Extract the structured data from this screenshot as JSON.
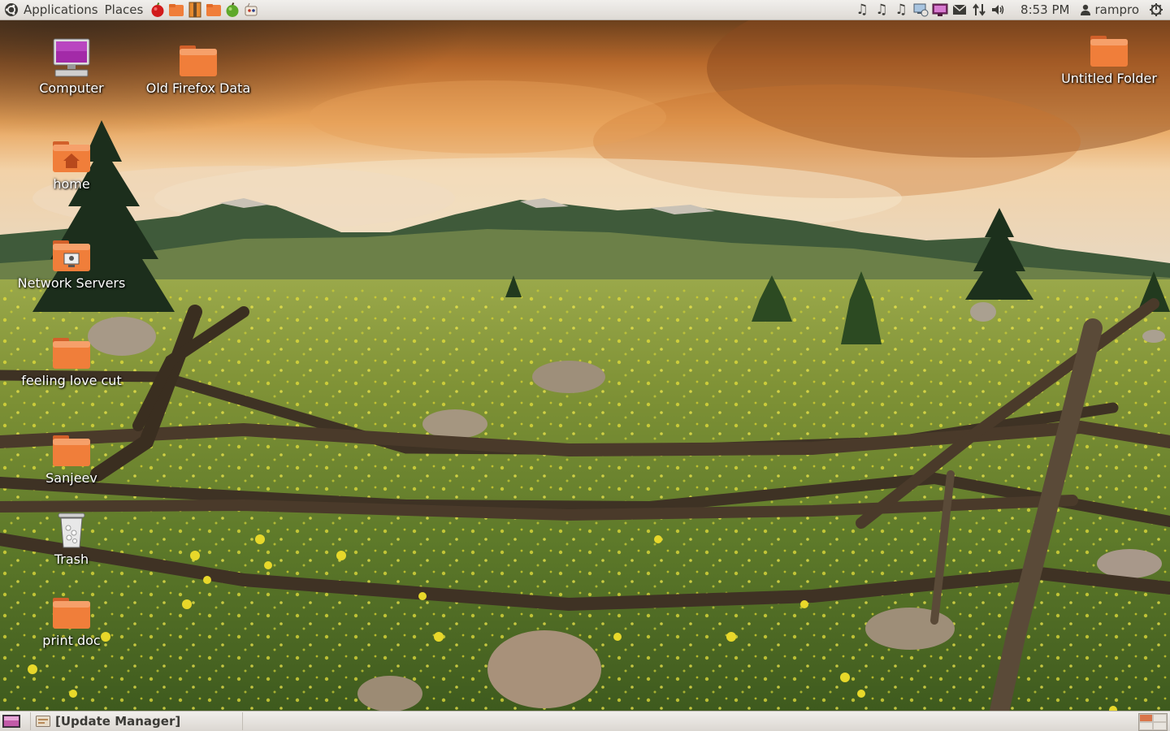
{
  "top_panel": {
    "menus": [
      "Applications",
      "Places"
    ],
    "launchers": [
      "apple-red-icon",
      "file-manager-icon",
      "archive-icon",
      "folder-icon",
      "apple-green-icon",
      "game-icon"
    ],
    "tray_icons": [
      "music-note-icon",
      "music-note-icon",
      "music-note-icon",
      "network-monitor-icon",
      "display-icon",
      "mail-icon",
      "network-updown-icon",
      "volume-icon"
    ],
    "clock": "8:53 PM",
    "user": "rampro",
    "power_icon": "gear-power-icon"
  },
  "desktop": {
    "icons": [
      {
        "label": "Computer",
        "icon": "computer-icon"
      },
      {
        "label": "Old Firefox Data",
        "icon": "folder-icon"
      },
      {
        "label": "Untitled Folder",
        "icon": "folder-icon"
      },
      {
        "label": "home",
        "icon": "home-folder-icon"
      },
      {
        "label": "Network Servers",
        "icon": "network-folder-icon"
      },
      {
        "label": "feeling love cut",
        "icon": "folder-icon"
      },
      {
        "label": "Sanjeev",
        "icon": "folder-icon"
      },
      {
        "label": "Trash",
        "icon": "trash-icon"
      },
      {
        "label": "print doc",
        "icon": "folder-icon"
      }
    ]
  },
  "bottom_panel": {
    "task_label": "[Update Manager]",
    "workspace_count": 4
  },
  "colors": {
    "folder_orange": "#f07e3a",
    "panel_bg": "#e6e2dd",
    "panel_text": "#3c3b37"
  }
}
